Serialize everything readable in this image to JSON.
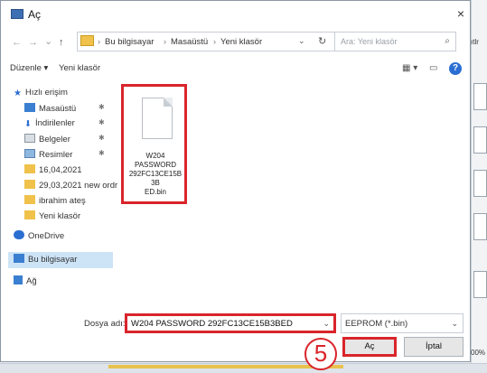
{
  "window": {
    "title": "Aç",
    "close_glyph": "×"
  },
  "address_bar": {
    "crumbs": [
      "Bu bilgisayar",
      "Masaüstü",
      "Yeni klasör"
    ],
    "separator": "›",
    "dropdown_glyph": "⌄",
    "refresh_glyph": "↻"
  },
  "nav_arrows": {
    "back": "←",
    "forward": "→",
    "recent": "⌄",
    "up": "↑"
  },
  "search": {
    "placeholder": "Ara: Yeni klasör",
    "icon": "search-icon"
  },
  "command_bar": {
    "organize": "Düzenle ▾",
    "new_folder": "Yeni klasör",
    "help": "?"
  },
  "nav_pane": {
    "items": [
      {
        "label": "Hızlı erişim",
        "icon": "star-icon",
        "pinned": false
      },
      {
        "label": "Masaüstü",
        "icon": "desktop-icon",
        "pinned": true
      },
      {
        "label": "İndirilenler",
        "icon": "download-icon",
        "pinned": true
      },
      {
        "label": "Belgeler",
        "icon": "documents-icon",
        "pinned": true
      },
      {
        "label": "Resimler",
        "icon": "pictures-icon",
        "pinned": true
      },
      {
        "label": "16,04,2021",
        "icon": "folder-icon",
        "pinned": false
      },
      {
        "label": "29,03,2021 new ordr",
        "icon": "folder-icon",
        "pinned": false
      },
      {
        "label": "ibrahim ateş",
        "icon": "folder-icon",
        "pinned": false
      },
      {
        "label": "Yeni klasör",
        "icon": "folder-icon",
        "pinned": false
      },
      {
        "label": "OneDrive",
        "icon": "cloud-icon",
        "pinned": false
      },
      {
        "label": "Bu bilgisayar",
        "icon": "computer-icon",
        "pinned": false
      },
      {
        "label": "Ağ",
        "icon": "network-icon",
        "pinned": false
      }
    ],
    "pin_glyph": "✱"
  },
  "content": {
    "files": [
      {
        "name": "W204 PASSWORD 292FC13CE15B3BED.bin",
        "display_lines": "W204\nPASSWORD\n292FC13CE15B3B\nED.bin"
      }
    ]
  },
  "footer": {
    "filename_label": "Dosya adı:",
    "filename_value": "W204 PASSWORD 292FC13CE15B3BED",
    "filetype_value": "EEPROM (*.bin)",
    "dropdown_glyph": "⌄",
    "open_label": "Aç",
    "cancel_label": "İptal"
  },
  "annotation": {
    "step": "5"
  },
  "background": {
    "zoom_text": "00%",
    "side_text": "ıtlr"
  },
  "colors": {
    "highlight": "#d9252b",
    "accent": "#2b6ed2",
    "folder": "#f0c24b"
  }
}
